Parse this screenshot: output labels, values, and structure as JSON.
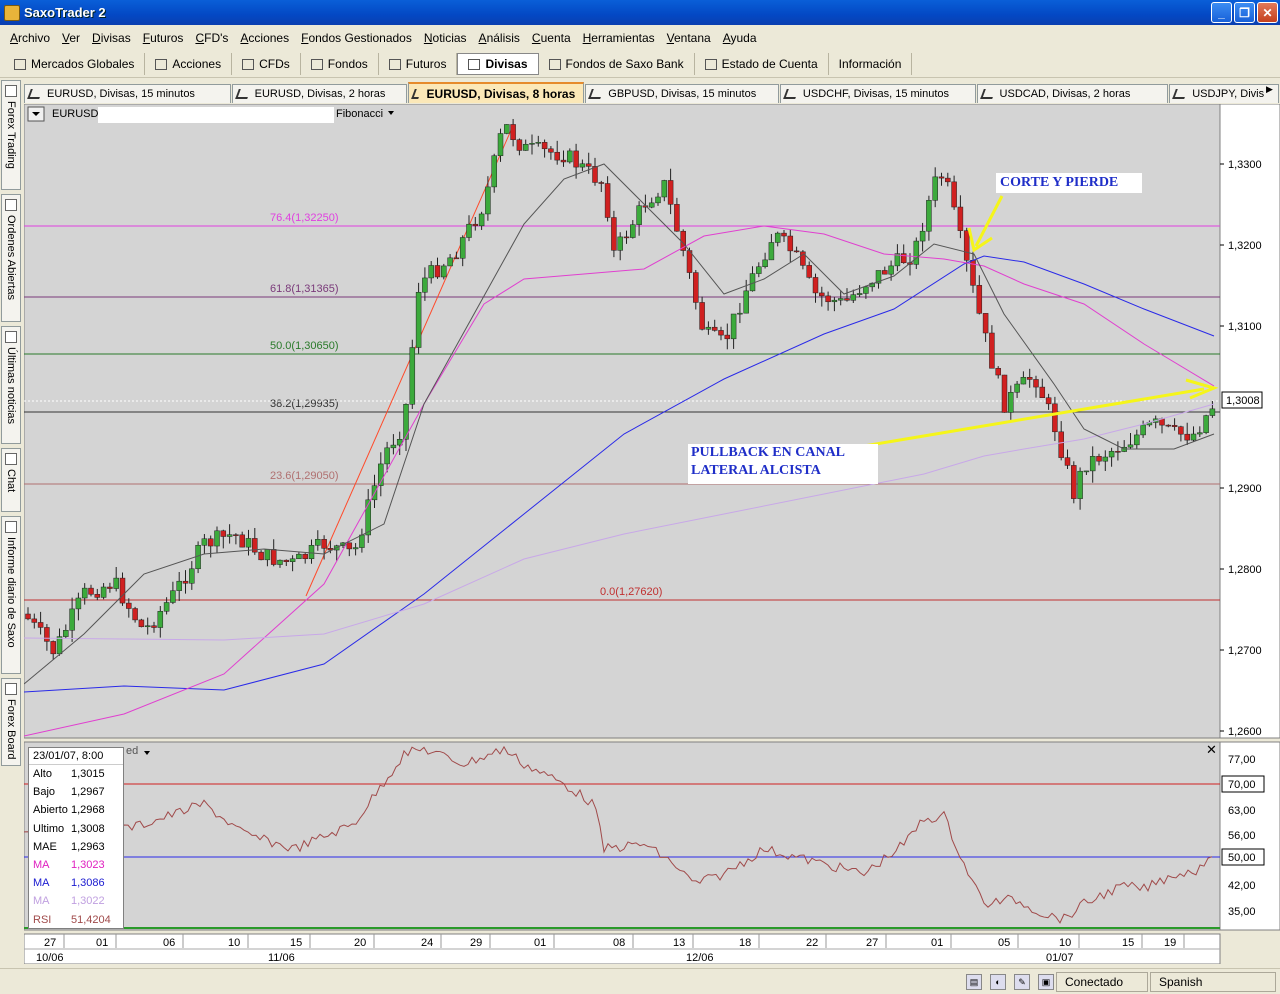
{
  "window": {
    "title": "SaxoTrader 2"
  },
  "menu": [
    "Archivo",
    "Ver",
    "Divisas",
    "Futuros",
    "CFD's",
    "Acciones",
    "Fondos Gestionados",
    "Noticias",
    "Análisis",
    "Cuenta",
    "Herramientas",
    "Ventana",
    "Ayuda"
  ],
  "toolbar": [
    {
      "label": "Mercados Globales",
      "icon": "globe-icon"
    },
    {
      "label": "Acciones",
      "icon": "chart-icon"
    },
    {
      "label": "CFDs",
      "icon": "chart-icon"
    },
    {
      "label": "Fondos",
      "icon": "chart-icon"
    },
    {
      "label": "Futuros",
      "icon": "chart-icon"
    },
    {
      "label": "Divisas",
      "icon": "currency-icon",
      "active": true
    },
    {
      "label": "Fondos de Saxo Bank",
      "icon": "chart-icon"
    },
    {
      "label": "Estado de Cuenta",
      "icon": "account-icon"
    },
    {
      "label": "Información",
      "icon": ""
    }
  ],
  "tabs": [
    {
      "label": "EURUSD, Divisas, 15 minutos"
    },
    {
      "label": "EURUSD, Divisas, 2 horas"
    },
    {
      "label": "EURUSD, Divisas, 8 horas",
      "active": true
    },
    {
      "label": "GBPUSD, Divisas, 15 minutos"
    },
    {
      "label": "USDCHF, Divisas, 15 minutos"
    },
    {
      "label": "USDCAD, Divisas, 2 horas"
    },
    {
      "label": "USDJPY, Divis"
    }
  ],
  "sidebar": [
    "Forex Trading",
    "Ordenes Abiertas",
    "Últimas noticias",
    "Chat",
    "Informe diario de Saxo",
    "Forex Board"
  ],
  "chart": {
    "symbol": "EURUSD",
    "tool": "Fibonacci",
    "indicator_label": "ed",
    "price_axis": [
      "1,3300",
      "1,3200",
      "1,3100",
      "1,2900",
      "1,2800",
      "1,2700",
      "1,2600"
    ],
    "current_price": "1,3008",
    "fib_levels": [
      {
        "label": "76.4(1,32250)",
        "color": "#e040e0"
      },
      {
        "label": "61.8(1,31365)",
        "color": "#7a3a7a"
      },
      {
        "label": "50.0(1,30650)",
        "color": "#2a7a2a"
      },
      {
        "label": "38.2(1,29935)",
        "color": "#333333"
      },
      {
        "label": "23.6(1,29050)",
        "color": "#b07070"
      },
      {
        "label": "0.0(1,27620)",
        "color": "#c03030"
      }
    ],
    "rsi_axis": [
      "77,00",
      "70,00",
      "63,00",
      "56,00",
      "50,00",
      "42,00",
      "35,00"
    ],
    "date_axis": [
      "27",
      "01",
      "06",
      "10",
      "15",
      "20",
      "24",
      "29",
      "01",
      "08",
      "13",
      "18",
      "22",
      "27",
      "01",
      "05",
      "10",
      "15",
      "19"
    ],
    "month_axis": [
      "10/06",
      "11/06",
      "12/06",
      "01/07"
    ],
    "annotations": [
      "CORTE Y  PIERDE",
      "PULLBACK EN CANAL",
      "LATERAL ALCISTA"
    ]
  },
  "info": {
    "date": "23/01/07, 8:00",
    "rows": [
      {
        "k": "Alto",
        "v": "1,3015",
        "color": "#000000"
      },
      {
        "k": "Bajo",
        "v": "1,2967",
        "color": "#000000"
      },
      {
        "k": "Abierto",
        "v": "1,2968",
        "color": "#000000"
      },
      {
        "k": "Ultimo",
        "v": "1,3008",
        "color": "#000000"
      },
      {
        "k": "MAE",
        "v": "1,2963",
        "color": "#000000"
      },
      {
        "k": "MA",
        "v": "1,3023",
        "color": "#e020c0"
      },
      {
        "k": "MA",
        "v": "1,3086",
        "color": "#1a1ad0"
      },
      {
        "k": "MA",
        "v": "1,3022",
        "color": "#c0a0e0"
      },
      {
        "k": "RSI",
        "v": "51,4204",
        "color": "#a04a4a"
      }
    ]
  },
  "status": {
    "connection": "Conectado",
    "language": "Spanish"
  }
}
